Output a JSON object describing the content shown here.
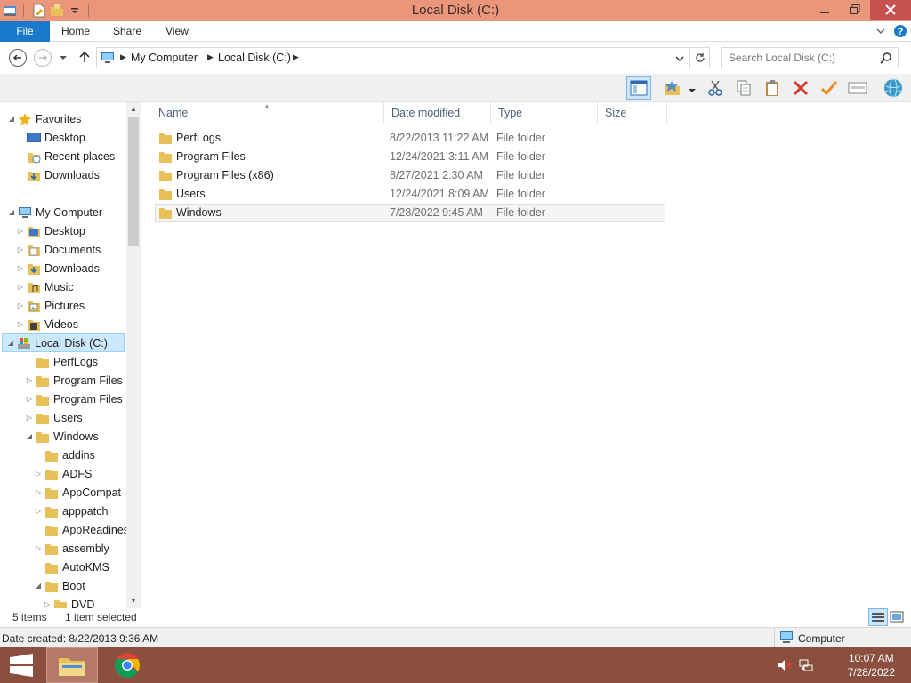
{
  "window": {
    "title": "Local Disk (C:)"
  },
  "ribbon": {
    "tabs": [
      {
        "label": "File"
      },
      {
        "label": "Home"
      },
      {
        "label": "Share"
      },
      {
        "label": "View"
      }
    ]
  },
  "address": {
    "crumbs": [
      "My Computer",
      "Local Disk (C:)"
    ],
    "search_placeholder": "Search Local Disk (C:)"
  },
  "nav": {
    "favorites_label": "Favorites",
    "favorites": [
      "Desktop",
      "Recent places",
      "Downloads"
    ],
    "computer_label": "My Computer",
    "computer": [
      "Desktop",
      "Documents",
      "Downloads",
      "Music",
      "Pictures",
      "Videos"
    ],
    "drive_label": "Local Disk (C:)",
    "drive_children": [
      "PerfLogs",
      "Program Files",
      "Program Files (",
      "Users",
      "Windows"
    ],
    "windows_children": [
      "addins",
      "ADFS",
      "AppCompat",
      "apppatch",
      "AppReadines",
      "assembly",
      "AutoKMS",
      "Boot"
    ],
    "boot_children": [
      "DVD"
    ]
  },
  "files": {
    "columns": [
      "Name",
      "Date modified",
      "Type",
      "Size"
    ],
    "rows": [
      {
        "name": "PerfLogs",
        "date": "8/22/2013 11:22 AM",
        "type": "File folder",
        "size": ""
      },
      {
        "name": "Program Files",
        "date": "12/24/2021 3:11 AM",
        "type": "File folder",
        "size": ""
      },
      {
        "name": "Program Files (x86)",
        "date": "8/27/2021 2:30 AM",
        "type": "File folder",
        "size": ""
      },
      {
        "name": "Users",
        "date": "12/24/2021 8:09 AM",
        "type": "File folder",
        "size": ""
      },
      {
        "name": "Windows",
        "date": "7/28/2022 9:45 AM",
        "type": "File folder",
        "size": ""
      }
    ],
    "selected_index": 4
  },
  "status": {
    "item_count": "5 items",
    "selection": "1 item selected",
    "details": "Date created: 8/22/2013 9:36 AM",
    "location": "Computer"
  },
  "taskbar": {
    "time": "10:07 AM",
    "date": "7/28/2022"
  },
  "colors": {
    "titlebar": "#e9967a",
    "file_tab": "#1979ca",
    "taskbar": "#8a4f3f",
    "selection": "#cce8ff",
    "folder": "#e8c05a"
  }
}
